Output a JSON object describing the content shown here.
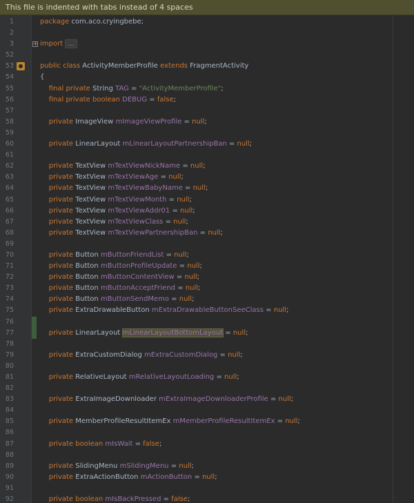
{
  "notice": "This file is indented with tabs instead of 4 spaces",
  "lines": [
    {
      "n": "1",
      "tokens": [
        {
          "t": "package ",
          "c": "kw"
        },
        {
          "t": "com.aco.cryingbebe;"
        }
      ]
    },
    {
      "n": "2",
      "tokens": []
    },
    {
      "n": "3",
      "fold": true,
      "tokens": [
        {
          "t": "import ",
          "c": "kw"
        },
        {
          "t": "...",
          "c": "collapsed"
        }
      ]
    },
    {
      "n": "52",
      "tokens": []
    },
    {
      "n": "53",
      "icon": "override-marker-icon",
      "tokens": [
        {
          "t": "public ",
          "c": "kw"
        },
        {
          "t": "class ",
          "c": "kw"
        },
        {
          "t": "ActivityMemberProfile "
        },
        {
          "t": "extends ",
          "c": "kw"
        },
        {
          "t": "FragmentActivity"
        }
      ]
    },
    {
      "n": "54",
      "tokens": [
        {
          "t": "{"
        }
      ]
    },
    {
      "n": "55",
      "tokens": [
        {
          "t": "    final ",
          "c": "kw"
        },
        {
          "t": "private ",
          "c": "kw"
        },
        {
          "t": "String "
        },
        {
          "t": "TAG",
          "c": "fld"
        },
        {
          "t": " = "
        },
        {
          "t": "\"ActivityMemberProfile\"",
          "c": "str"
        },
        {
          "t": ";"
        }
      ]
    },
    {
      "n": "56",
      "tokens": [
        {
          "t": "    final ",
          "c": "kw"
        },
        {
          "t": "private ",
          "c": "kw"
        },
        {
          "t": "boolean ",
          "c": "kw"
        },
        {
          "t": "DEBUG",
          "c": "fld"
        },
        {
          "t": " = "
        },
        {
          "t": "false",
          "c": "kw"
        },
        {
          "t": ";"
        }
      ]
    },
    {
      "n": "57",
      "tokens": []
    },
    {
      "n": "58",
      "tokens": [
        {
          "t": "    private ",
          "c": "kw"
        },
        {
          "t": "ImageView "
        },
        {
          "t": "mImageViewProfile",
          "c": "fld"
        },
        {
          "t": " = "
        },
        {
          "t": "null",
          "c": "kw"
        },
        {
          "t": ";"
        }
      ]
    },
    {
      "n": "59",
      "tokens": []
    },
    {
      "n": "60",
      "tokens": [
        {
          "t": "    private ",
          "c": "kw"
        },
        {
          "t": "LinearLayout "
        },
        {
          "t": "mLinearLayoutPartnershipBan",
          "c": "fld"
        },
        {
          "t": " = "
        },
        {
          "t": "null",
          "c": "kw"
        },
        {
          "t": ";"
        }
      ]
    },
    {
      "n": "61",
      "tokens": []
    },
    {
      "n": "62",
      "tokens": [
        {
          "t": "    private ",
          "c": "kw"
        },
        {
          "t": "TextView "
        },
        {
          "t": "mTextViewNickName",
          "c": "fld"
        },
        {
          "t": " = "
        },
        {
          "t": "null",
          "c": "kw"
        },
        {
          "t": ";"
        }
      ]
    },
    {
      "n": "63",
      "tokens": [
        {
          "t": "    private ",
          "c": "kw"
        },
        {
          "t": "TextView "
        },
        {
          "t": "mTextViewAge",
          "c": "fld"
        },
        {
          "t": " = "
        },
        {
          "t": "null",
          "c": "kw"
        },
        {
          "t": ";"
        }
      ]
    },
    {
      "n": "64",
      "tokens": [
        {
          "t": "    private ",
          "c": "kw"
        },
        {
          "t": "TextView "
        },
        {
          "t": "mTextViewBabyName",
          "c": "fld"
        },
        {
          "t": " = "
        },
        {
          "t": "null",
          "c": "kw"
        },
        {
          "t": ";"
        }
      ]
    },
    {
      "n": "65",
      "tokens": [
        {
          "t": "    private ",
          "c": "kw"
        },
        {
          "t": "TextView "
        },
        {
          "t": "mTextViewMonth",
          "c": "fld"
        },
        {
          "t": " = "
        },
        {
          "t": "null",
          "c": "kw"
        },
        {
          "t": ";"
        }
      ]
    },
    {
      "n": "66",
      "tokens": [
        {
          "t": "    private ",
          "c": "kw"
        },
        {
          "t": "TextView "
        },
        {
          "t": "mTextViewAddr01",
          "c": "fld"
        },
        {
          "t": " = "
        },
        {
          "t": "null",
          "c": "kw"
        },
        {
          "t": ";"
        }
      ]
    },
    {
      "n": "67",
      "tokens": [
        {
          "t": "    private ",
          "c": "kw"
        },
        {
          "t": "TextView "
        },
        {
          "t": "mTextViewClass",
          "c": "fld"
        },
        {
          "t": " = "
        },
        {
          "t": "null",
          "c": "kw"
        },
        {
          "t": ";"
        }
      ]
    },
    {
      "n": "68",
      "tokens": [
        {
          "t": "    private ",
          "c": "kw"
        },
        {
          "t": "TextView "
        },
        {
          "t": "mTextViewPartnershipBan",
          "c": "fld"
        },
        {
          "t": " = "
        },
        {
          "t": "null",
          "c": "kw"
        },
        {
          "t": ";"
        }
      ]
    },
    {
      "n": "69",
      "tokens": []
    },
    {
      "n": "70",
      "tokens": [
        {
          "t": "    private ",
          "c": "kw"
        },
        {
          "t": "Button "
        },
        {
          "t": "mButtonFriendList",
          "c": "fld"
        },
        {
          "t": " = "
        },
        {
          "t": "null",
          "c": "kw"
        },
        {
          "t": ";"
        }
      ]
    },
    {
      "n": "71",
      "tokens": [
        {
          "t": "    private ",
          "c": "kw"
        },
        {
          "t": "Button "
        },
        {
          "t": "mButtonProfileUpdate",
          "c": "fld"
        },
        {
          "t": " = "
        },
        {
          "t": "null",
          "c": "kw"
        },
        {
          "t": ";"
        }
      ]
    },
    {
      "n": "72",
      "tokens": [
        {
          "t": "    private ",
          "c": "kw"
        },
        {
          "t": "Button "
        },
        {
          "t": "mButtonContentView",
          "c": "fld"
        },
        {
          "t": " = "
        },
        {
          "t": "null",
          "c": "kw"
        },
        {
          "t": ";"
        }
      ]
    },
    {
      "n": "73",
      "tokens": [
        {
          "t": "    private ",
          "c": "kw"
        },
        {
          "t": "Button "
        },
        {
          "t": "mButtonAcceptFriend",
          "c": "fld"
        },
        {
          "t": " = "
        },
        {
          "t": "null",
          "c": "kw"
        },
        {
          "t": ";"
        }
      ]
    },
    {
      "n": "74",
      "tokens": [
        {
          "t": "    private ",
          "c": "kw"
        },
        {
          "t": "Button "
        },
        {
          "t": "mButtonSendMemo",
          "c": "fld"
        },
        {
          "t": " = "
        },
        {
          "t": "null",
          "c": "kw"
        },
        {
          "t": ";"
        }
      ]
    },
    {
      "n": "75",
      "tokens": [
        {
          "t": "    private ",
          "c": "kw"
        },
        {
          "t": "ExtraDrawableButton "
        },
        {
          "t": "mExtraDrawableButtonSeeClass",
          "c": "fld"
        },
        {
          "t": " = "
        },
        {
          "t": "null",
          "c": "kw"
        },
        {
          "t": ";"
        }
      ]
    },
    {
      "n": "76",
      "changed": true,
      "tokens": []
    },
    {
      "n": "77",
      "changed": true,
      "tokens": [
        {
          "t": "    private ",
          "c": "kw"
        },
        {
          "t": "LinearLayout "
        },
        {
          "t": "mLinearLayoutBottomLayout",
          "c": "fld hl"
        },
        {
          "t": " = "
        },
        {
          "t": "null",
          "c": "kw"
        },
        {
          "t": ";"
        }
      ]
    },
    {
      "n": "78",
      "tokens": []
    },
    {
      "n": "79",
      "tokens": [
        {
          "t": "    private ",
          "c": "kw"
        },
        {
          "t": "ExtraCustomDialog "
        },
        {
          "t": "mExtraCustomDialog",
          "c": "fld"
        },
        {
          "t": " = "
        },
        {
          "t": "null",
          "c": "kw"
        },
        {
          "t": ";"
        }
      ]
    },
    {
      "n": "80",
      "tokens": []
    },
    {
      "n": "81",
      "tokens": [
        {
          "t": "    private ",
          "c": "kw"
        },
        {
          "t": "RelativeLayout "
        },
        {
          "t": "mRelativeLayoutLoading",
          "c": "fld"
        },
        {
          "t": " = "
        },
        {
          "t": "null",
          "c": "kw"
        },
        {
          "t": ";"
        }
      ]
    },
    {
      "n": "82",
      "tokens": []
    },
    {
      "n": "83",
      "tokens": [
        {
          "t": "    private ",
          "c": "kw"
        },
        {
          "t": "ExtraImageDownloader "
        },
        {
          "t": "mExtraImageDownloaderProfile",
          "c": "fld"
        },
        {
          "t": " = "
        },
        {
          "t": "null",
          "c": "kw"
        },
        {
          "t": ";"
        }
      ]
    },
    {
      "n": "84",
      "tokens": []
    },
    {
      "n": "85",
      "tokens": [
        {
          "t": "    private ",
          "c": "kw"
        },
        {
          "t": "MemberProfileResultItemEx "
        },
        {
          "t": "mMemberProfileResultItemEx",
          "c": "fld"
        },
        {
          "t": " = "
        },
        {
          "t": "null",
          "c": "kw"
        },
        {
          "t": ";"
        }
      ]
    },
    {
      "n": "86",
      "tokens": []
    },
    {
      "n": "87",
      "tokens": [
        {
          "t": "    private ",
          "c": "kw"
        },
        {
          "t": "boolean ",
          "c": "kw"
        },
        {
          "t": "mIsWait",
          "c": "fld"
        },
        {
          "t": " = "
        },
        {
          "t": "false",
          "c": "kw"
        },
        {
          "t": ";"
        }
      ]
    },
    {
      "n": "88",
      "tokens": []
    },
    {
      "n": "89",
      "tokens": [
        {
          "t": "    private ",
          "c": "kw"
        },
        {
          "t": "SlidingMenu "
        },
        {
          "t": "mSlidingMenu",
          "c": "fld"
        },
        {
          "t": " = "
        },
        {
          "t": "null",
          "c": "kw"
        },
        {
          "t": ";"
        }
      ]
    },
    {
      "n": "90",
      "tokens": [
        {
          "t": "    private ",
          "c": "kw"
        },
        {
          "t": "ExtraActionButton "
        },
        {
          "t": "mActionButton",
          "c": "fld"
        },
        {
          "t": " = "
        },
        {
          "t": "null",
          "c": "kw"
        },
        {
          "t": ";"
        }
      ]
    },
    {
      "n": "91",
      "tokens": []
    },
    {
      "n": "92",
      "tokens": [
        {
          "t": "    private ",
          "c": "kw"
        },
        {
          "t": "boolean ",
          "c": "kw"
        },
        {
          "t": "mIsBackPressed",
          "c": "fld"
        },
        {
          "t": " = "
        },
        {
          "t": "false",
          "c": "kw"
        },
        {
          "t": ";"
        }
      ]
    }
  ]
}
